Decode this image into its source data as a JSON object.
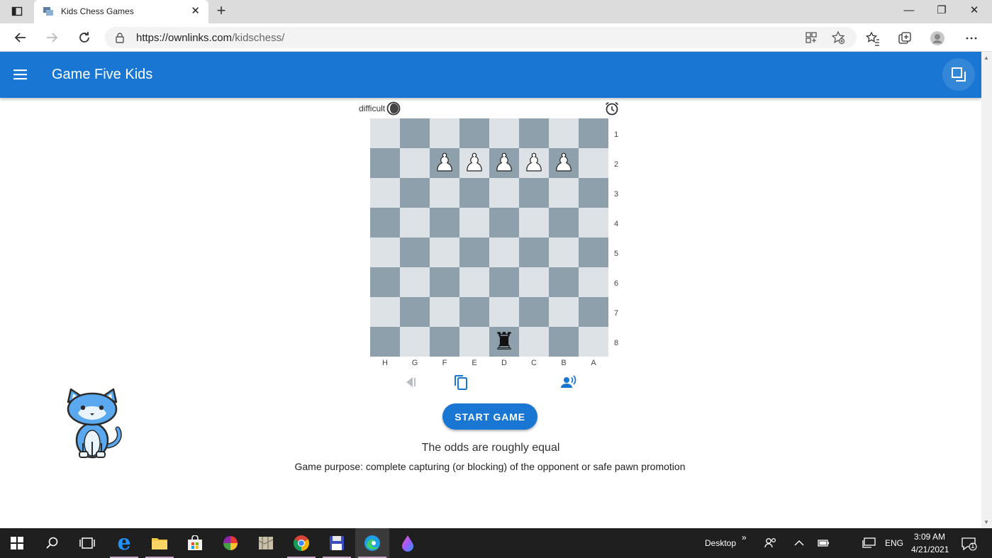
{
  "browser": {
    "tab_title": "Kids Chess Games",
    "tab_close": "✕",
    "new_tab": "+",
    "url_host": "https://ownlinks.com",
    "url_path": "/kidschess/",
    "window_controls": [
      "—",
      "❐",
      "✕"
    ]
  },
  "app": {
    "title": "Game Five Kids",
    "accent_color": "#1976d2"
  },
  "game": {
    "difficulty_label": "difficult",
    "ranks": [
      "1",
      "2",
      "3",
      "4",
      "5",
      "6",
      "7",
      "8"
    ],
    "files": [
      "H",
      "G",
      "F",
      "E",
      "D",
      "C",
      "B",
      "A"
    ],
    "pieces": [
      {
        "square": "F2",
        "glyph": "♟",
        "color": "white"
      },
      {
        "square": "E2",
        "glyph": "♟",
        "color": "white"
      },
      {
        "square": "D2",
        "glyph": "♟",
        "color": "white"
      },
      {
        "square": "C2",
        "glyph": "♟",
        "color": "white"
      },
      {
        "square": "B2",
        "glyph": "♟",
        "color": "white"
      },
      {
        "square": "D8",
        "glyph": "♜",
        "color": "black"
      }
    ],
    "start_button": "START GAME",
    "status": "The odds are roughly equal",
    "purpose": "Game purpose: complete capturing (or blocking) of the opponent or safe pawn promotion"
  },
  "taskbar": {
    "desktop_label": "Desktop",
    "chevron": "»",
    "language": "ENG",
    "time": "3:09 AM",
    "date": "4/21/2021",
    "notification_count": "1"
  }
}
